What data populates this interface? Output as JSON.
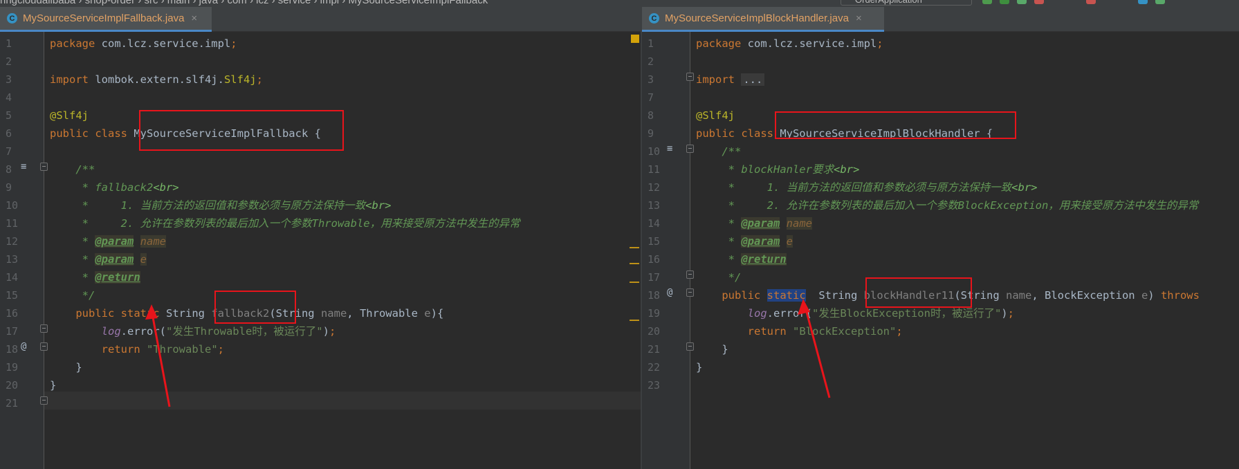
{
  "top_bar": {
    "breadcrumb": "ringcloudalibaba › shop-order › src › main › java › com › lcz › service › impl › MySourceServiceImplFallback",
    "run_config": "OrderApplication"
  },
  "left_editor": {
    "tab": {
      "icon": "C",
      "filename": "MySourceServiceImplFallback.java",
      "close": "×"
    },
    "lines": [
      {
        "n": "1",
        "html": "<span class='kw'>package</span> com.lcz.service.impl<span class='kw'>;</span>"
      },
      {
        "n": "2",
        "html": ""
      },
      {
        "n": "3",
        "html": "<span class='kw'>import</span> lombok.extern.slf4j.<span class='ann'>Slf4j</span><span class='kw'>;</span>"
      },
      {
        "n": "4",
        "html": ""
      },
      {
        "n": "5",
        "html": "<span class='ann'>@Slf4j</span>"
      },
      {
        "n": "6",
        "html": "<span class='kw'>public class</span> MySourceServiceImplFallback {"
      },
      {
        "n": "7",
        "html": ""
      },
      {
        "n": "8",
        "html": "    <span class='doc'>/**</span>"
      },
      {
        "n": "9",
        "html": "<span class='doc'>     * fallback2</span><span class='dhtml'>&lt;br&gt;</span>"
      },
      {
        "n": "10",
        "html": "<span class='doc'>     *     1. 当前方法的返回值和参数必须与原方法保持一致</span><span class='dhtml'>&lt;br&gt;</span>"
      },
      {
        "n": "11",
        "html": "<span class='doc'>     *     2. 允许在参数列表的最后加入一个参数Throwable，用来接受原方法中发生的异常</span>"
      },
      {
        "n": "12",
        "html": "<span class='doc'>     * </span><span class='dtag'>@param</span> <span class='dval'>name</span>"
      },
      {
        "n": "13",
        "html": "<span class='doc'>     * </span><span class='dtag'>@param</span> <span class='dval'>e</span>"
      },
      {
        "n": "14",
        "html": "<span class='doc'>     * </span><span class='dtag'>@return</span>"
      },
      {
        "n": "15",
        "html": "<span class='doc'>     */</span>"
      },
      {
        "n": "16",
        "html": "    <span class='kw'>public static</span> String <span class='unused'>fallback2</span>(String <span class='param'>name</span>, Throwable <span class='param'>e</span>){"
      },
      {
        "n": "17",
        "html": "        <span class='field'>log</span>.error(<span class='str'>\"发生Throwable时，被运行了\"</span>)<span class='kw'>;</span>"
      },
      {
        "n": "18",
        "html": "        <span class='kw'>return</span> <span class='str'>\"Throwable\"</span><span class='kw'>;</span>"
      },
      {
        "n": "19",
        "html": "    }"
      },
      {
        "n": "20",
        "html": "}"
      },
      {
        "n": "21",
        "html": ""
      }
    ]
  },
  "right_editor": {
    "tab": {
      "icon": "C",
      "filename": "MySourceServiceImplBlockHandler.java",
      "close": "×"
    },
    "lines": [
      {
        "n": "1",
        "html": "<span class='kw'>package</span> com.lcz.service.impl<span class='kw'>;</span>"
      },
      {
        "n": "2",
        "html": ""
      },
      {
        "n": "3",
        "html": "<span class='kw'>import</span> <span class='fold-text'>...</span>"
      },
      {
        "n": "7",
        "html": ""
      },
      {
        "n": "8",
        "html": "<span class='ann'>@Slf4j</span>"
      },
      {
        "n": "9",
        "html": "<span class='kw'>public class</span> MySourceServiceImplBlockHandler {"
      },
      {
        "n": "10",
        "html": "    <span class='doc'>/**</span>"
      },
      {
        "n": "11",
        "html": "<span class='doc'>     * blockHanler要求</span><span class='dhtml'>&lt;br&gt;</span>"
      },
      {
        "n": "12",
        "html": "<span class='doc'>     *     1. 当前方法的返回值和参数必须与原方法保持一致</span><span class='dhtml'>&lt;br&gt;</span>"
      },
      {
        "n": "13",
        "html": "<span class='doc'>     *     2. 允许在参数列表的最后加入一个参数BlockException，用来接受原方法中发生的异常</span>"
      },
      {
        "n": "14",
        "html": "<span class='doc'>     * </span><span class='dtag'>@param</span> <span class='dval'>name</span>"
      },
      {
        "n": "15",
        "html": "<span class='doc'>     * </span><span class='dtag'>@param</span> <span class='dval'>e</span>"
      },
      {
        "n": "16",
        "html": "<span class='doc'>     * </span><span class='dtag'>@return</span>"
      },
      {
        "n": "17",
        "html": "<span class='doc'>     */</span>"
      },
      {
        "n": "18",
        "html": "    <span class='kw'>public</span> <span class='hl-static'>static</span>  String <span class='unused'>blockHandler11</span>(String <span class='param'>name</span>, BlockException <span class='param'>e</span>) <span class='kw'>throws</span>"
      },
      {
        "n": "19",
        "html": "        <span class='field'>log</span>.error(<span class='str'>\"发生BlockException时，被运行了\"</span>)<span class='kw'>;</span>"
      },
      {
        "n": "20",
        "html": "        <span class='kw'>return</span> <span class='str'>\"BlockException\"</span><span class='kw'>;</span>"
      },
      {
        "n": "21",
        "html": "    }"
      },
      {
        "n": "22",
        "html": "}"
      },
      {
        "n": "23",
        "html": ""
      }
    ]
  },
  "colors": {
    "keyword": "#cc7832",
    "annotation": "#bbb529",
    "string": "#6a8759",
    "doc_comment": "#629755",
    "highlight_box": "#e8141b",
    "tab_filename": "#e2a265"
  }
}
